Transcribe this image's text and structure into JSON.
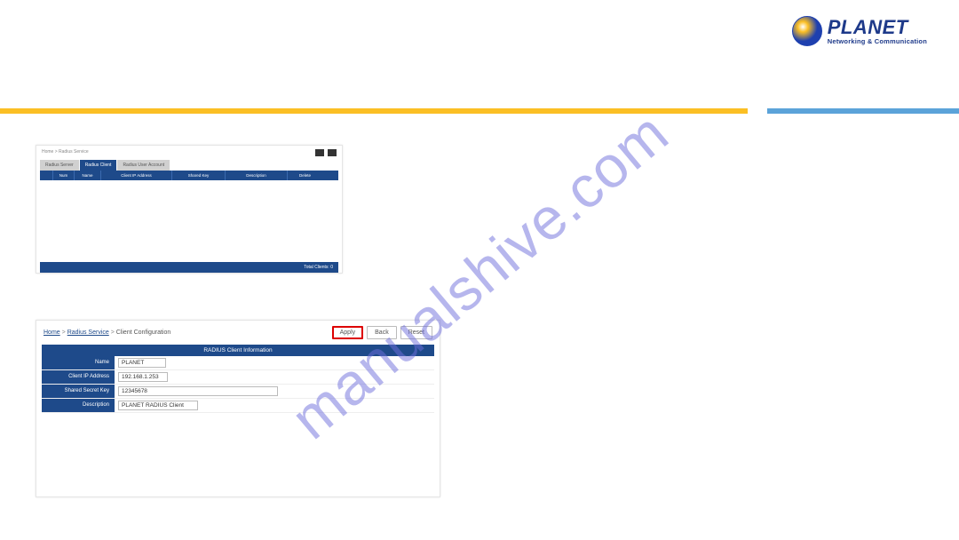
{
  "logo": {
    "title": "PLANET",
    "sub": "Networking & Communication"
  },
  "watermark": "manualshive.com",
  "panel1": {
    "breadcrumb": "Home > Radius Service",
    "tabs": {
      "t1": "Radius Server",
      "t2": "Radius Client",
      "t3": "Radius User Account"
    },
    "headers": {
      "chk": "",
      "num": "Num",
      "name": "Name",
      "ip": "Client IP Address",
      "key": "Shared Key",
      "desc": "Description",
      "del": "Delete"
    },
    "footer": "Total Clients: 0"
  },
  "panel2": {
    "crumb": {
      "home": "Home",
      "link": "Radius Service",
      "cur": "Client Configuration"
    },
    "buttons": {
      "apply": "Apply",
      "back": "Back",
      "reset": "Reset"
    },
    "section": "RADIUS Client Information",
    "labels": {
      "name": "Name",
      "ip": "Client IP Address",
      "key": "Shared Secret Key",
      "desc": "Description"
    },
    "values": {
      "name": "PLANET",
      "ip": "192.168.1.253",
      "key": "12345678",
      "desc": "PLANET RADIUS Client"
    }
  }
}
